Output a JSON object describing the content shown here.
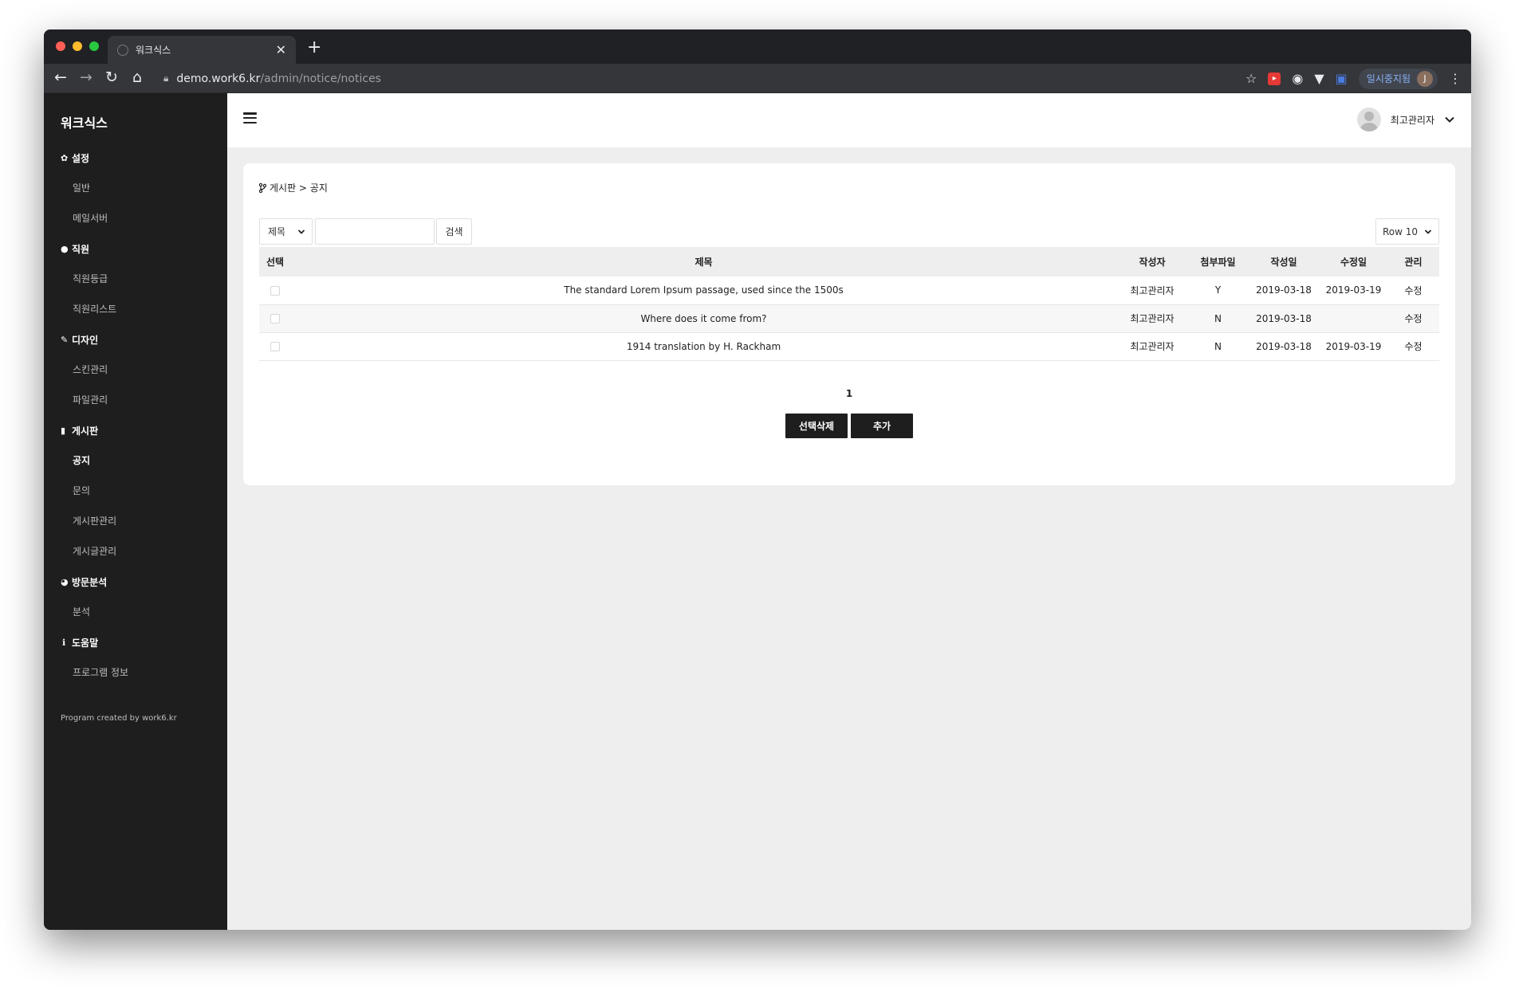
{
  "browser": {
    "tab_title": "워크식스",
    "url_host": "demo.work6.kr",
    "url_path": "/admin/notice/notices",
    "profile_label": "일시중지됨",
    "profile_initial": "J",
    "colors": {
      "close": "#ff5f57",
      "minimize": "#febc2e",
      "maximize": "#28c840"
    }
  },
  "sidebar": {
    "brand": "워크식스",
    "sections": [
      {
        "title": "설정",
        "icon": "gear-icon",
        "items": [
          {
            "label": "일반"
          },
          {
            "label": "메일서버"
          }
        ]
      },
      {
        "title": "직원",
        "icon": "user-icon",
        "items": [
          {
            "label": "직원등급"
          },
          {
            "label": "직원리스트"
          }
        ]
      },
      {
        "title": "디자인",
        "icon": "brush-icon",
        "items": [
          {
            "label": "스킨관리"
          },
          {
            "label": "파일관리"
          }
        ]
      },
      {
        "title": "게시판",
        "icon": "clipboard-icon",
        "items": [
          {
            "label": "공지",
            "active": true
          },
          {
            "label": "문의"
          },
          {
            "label": "게시판관리"
          },
          {
            "label": "게시글관리"
          }
        ]
      },
      {
        "title": "방문분석",
        "icon": "pie-chart-icon",
        "items": [
          {
            "label": "분석"
          }
        ]
      },
      {
        "title": "도움말",
        "icon": "info-icon",
        "items": [
          {
            "label": "프로그램 정보"
          }
        ]
      }
    ],
    "credit": "Program created by work6.kr"
  },
  "header": {
    "user_name": "최고관리자"
  },
  "breadcrumb": "게시판 > 공지",
  "search": {
    "field_selected": "제목",
    "value": "",
    "button_label": "검색",
    "rows_selected": "Row 10"
  },
  "table": {
    "columns": [
      "선택",
      "제목",
      "작성자",
      "첨부파일",
      "작성일",
      "수정일",
      "관리"
    ],
    "rows": [
      {
        "title": "The standard Lorem Ipsum passage, used since the 1500s",
        "author": "최고관리자",
        "attachment": "Y",
        "created": "2019-03-18",
        "modified": "2019-03-19",
        "action": "수정"
      },
      {
        "title": "Where does it come from?",
        "author": "최고관리자",
        "attachment": "N",
        "created": "2019-03-18",
        "modified": "",
        "action": "수정"
      },
      {
        "title": "1914 translation by H. Rackham",
        "author": "최고관리자",
        "attachment": "N",
        "created": "2019-03-18",
        "modified": "2019-03-19",
        "action": "수정"
      }
    ]
  },
  "pagination": {
    "current": "1"
  },
  "buttons": {
    "delete_selected": "선택삭제",
    "add": "추가"
  }
}
